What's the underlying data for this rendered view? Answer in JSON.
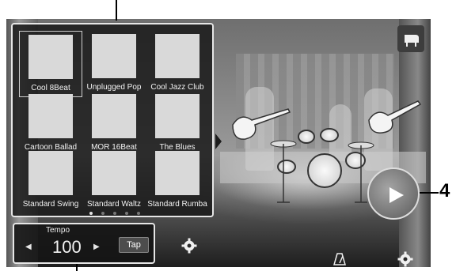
{
  "styles": [
    {
      "label": "Cool 8Beat",
      "icon": "microphone-icon",
      "selected": true
    },
    {
      "label": "Unplugged Pop",
      "icon": "microphone-icon"
    },
    {
      "label": "Cool Jazz Club",
      "icon": "jazz-band-icon"
    },
    {
      "label": "Cartoon Ballad",
      "icon": "film-reel-icon"
    },
    {
      "label": "MOR 16Beat",
      "icon": "electric-guitar-icon"
    },
    {
      "label": "The Blues",
      "icon": "acoustic-guitar-icon"
    },
    {
      "label": "Standard Swing",
      "icon": "cello-icon"
    },
    {
      "label": "Standard Waltz",
      "icon": "dancers-icon"
    },
    {
      "label": "Standard Rumba",
      "icon": "dancers-icon"
    }
  ],
  "pager": {
    "pages": 5,
    "current": 1
  },
  "tempo": {
    "label": "Tempo",
    "value": "100",
    "tap_label": "Tap"
  },
  "callout": {
    "number": "4"
  },
  "colors": {
    "panel_border": "#e6e6e6",
    "stage_light": "#c7c7c7"
  }
}
